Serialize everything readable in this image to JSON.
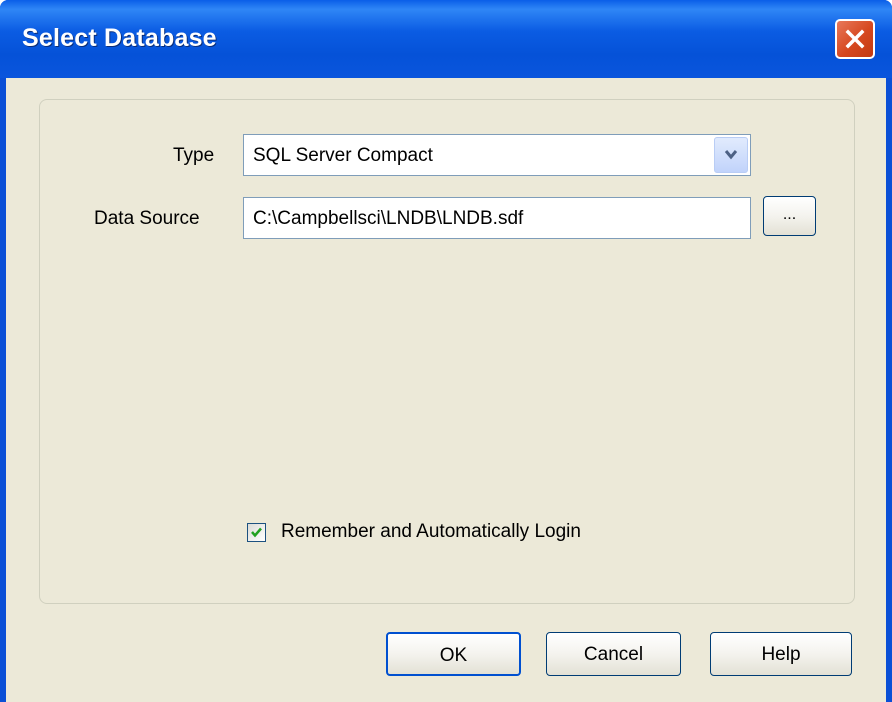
{
  "window": {
    "title": "Select Database"
  },
  "form": {
    "type_label": "Type",
    "type_value": "SQL Server Compact",
    "datasource_label": "Data Source",
    "datasource_value": "C:\\Campbellsci\\LNDB\\LNDB.sdf",
    "browse_label": "...",
    "remember_label": "Remember and Automatically Login",
    "remember_checked": true
  },
  "buttons": {
    "ok": "OK",
    "cancel": "Cancel",
    "help": "Help"
  },
  "icons": {
    "close": "close-icon",
    "dropdown": "chevron-down-icon",
    "check": "checkmark-icon"
  },
  "colors": {
    "title_bar": "#0a55dd",
    "close_button": "#d6481f",
    "client_bg": "#ece9d8",
    "check_green": "#21a121"
  }
}
